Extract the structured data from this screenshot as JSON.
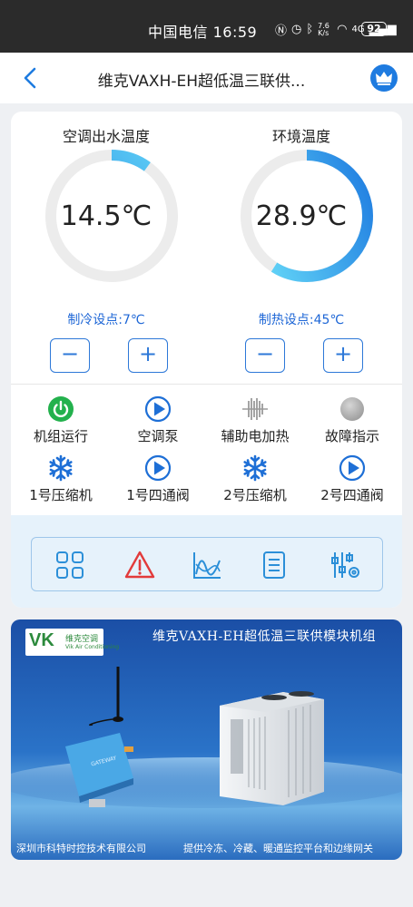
{
  "status_bar": {
    "carrier_time": "中国电信 16:59",
    "net_speed": "7.6 K/s",
    "signal": "4G",
    "battery": "92"
  },
  "header": {
    "title": "维克VAXH-EH超低温三联供...",
    "back_icon": "chevron-left-icon",
    "crown_icon": "crown-icon"
  },
  "gauges": [
    {
      "title": "空调出水温度",
      "value": "14.5℃",
      "setpoint": "制冷设点:7℃",
      "fill": 0.1,
      "colors": [
        "#1e7be0",
        "#5fd0f6"
      ]
    },
    {
      "title": "环境温度",
      "value": "28.9℃",
      "setpoint": "制热设点:45℃",
      "fill": 0.59,
      "colors": [
        "#1e7be0",
        "#5fd0f6"
      ]
    }
  ],
  "stepper": {
    "minus": "−",
    "plus": "+"
  },
  "indicators": [
    {
      "label": "机组运行",
      "icon": "power-on-icon"
    },
    {
      "label": "空调泵",
      "icon": "play-circle-icon"
    },
    {
      "label": "辅助电加热",
      "icon": "heater-coil-icon"
    },
    {
      "label": "故障指示",
      "icon": "fault-lamp-icon"
    },
    {
      "label": "1号压缩机",
      "icon": "snowflake-icon"
    },
    {
      "label": "1号四通阀",
      "icon": "play-circle-icon"
    },
    {
      "label": "2号压缩机",
      "icon": "snowflake-icon"
    },
    {
      "label": "2号四通阀",
      "icon": "play-circle-icon"
    }
  ],
  "toolbar": [
    {
      "icon": "grid-icon"
    },
    {
      "icon": "alarm-warning-icon"
    },
    {
      "icon": "trend-chart-icon"
    },
    {
      "icon": "list-document-icon"
    },
    {
      "icon": "settings-sliders-icon"
    }
  ],
  "banner": {
    "logo_mark": "VK",
    "logo_brand": "维克空调",
    "logo_brand_en": "Vik Air Conditioning",
    "title": "维克VAXH-EH超低温三联供模块机组",
    "footer_left": "深圳市科特时控技术有限公司",
    "footer_right": "提供冷冻、冷藏、暖通监控平台和边缘网关",
    "device_label": "GATEWAY"
  },
  "colors": {
    "accent": "#1e7be0",
    "accent_light": "#5fd0f6",
    "setpoint_text": "#1d66d6",
    "fault_red": "#e23b3b",
    "run_green": "#23b14d"
  }
}
